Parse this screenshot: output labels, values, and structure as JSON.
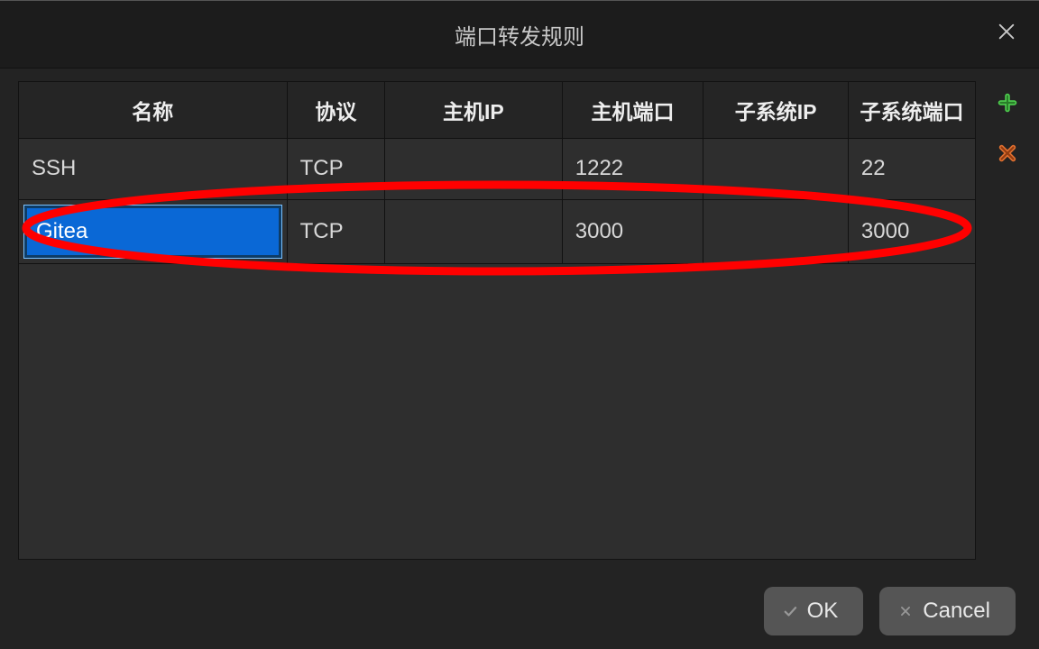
{
  "dialog": {
    "title": "端口转发规则"
  },
  "columns": {
    "name": "名称",
    "protocol": "协议",
    "host_ip": "主机IP",
    "host_port": "主机端口",
    "subsystem_ip": "子系统IP",
    "subsystem_port": "子系统端口"
  },
  "rows": [
    {
      "name": "SSH",
      "protocol": "TCP",
      "host_ip": "",
      "host_port": "1222",
      "subsystem_ip": "",
      "subsystem_port": "22",
      "editing": false
    },
    {
      "name": "Gitea",
      "protocol": "TCP",
      "host_ip": "",
      "host_port": "3000",
      "subsystem_ip": "",
      "subsystem_port": "3000",
      "editing": true
    }
  ],
  "buttons": {
    "ok": "OK",
    "cancel": "Cancel"
  },
  "icons": {
    "close": "close-icon",
    "add": "add-rule-icon",
    "remove": "remove-rule-icon",
    "ok_check": "check-icon",
    "cancel_x": "x-icon"
  },
  "annotation": {
    "highlight_row_index": 1,
    "color": "#ff0000"
  }
}
